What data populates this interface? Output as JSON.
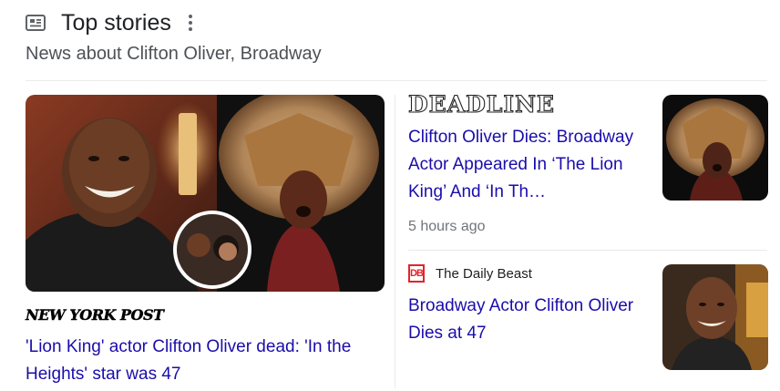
{
  "section": {
    "icon": "newspaper-icon",
    "title": "Top stories",
    "subtitle": "News about Clifton Oliver, Broadway",
    "menu_icon": "more-vert-icon"
  },
  "stories": [
    {
      "source": "NEW YORK POST",
      "headline": "'Lion King' actor Clifton Oliver dead: 'In the Heights' star was 47"
    },
    {
      "source": "DEADLINE",
      "headline": "Clifton Oliver Dies: Broadway Actor Appeared In ‘The Lion King’ And ‘In Th…",
      "time": "5 hours ago"
    },
    {
      "source": "The Daily Beast",
      "source_logo": "DB",
      "headline": "Broadway Actor Clifton Oliver Dies at 47"
    }
  ],
  "colors": {
    "link": "#1a0dab",
    "meta": "#70757a",
    "db_brand": "#e0252b"
  }
}
